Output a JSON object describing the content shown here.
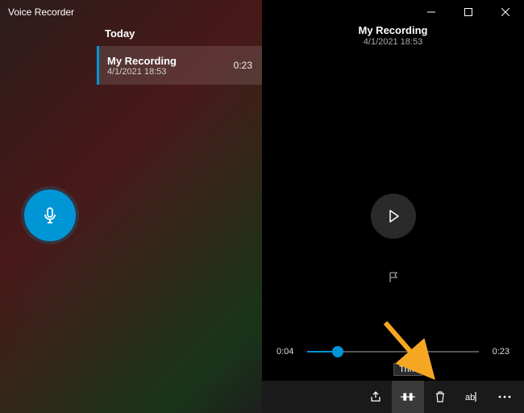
{
  "app": {
    "title": "Voice Recorder"
  },
  "list": {
    "header": "Today",
    "items": [
      {
        "name": "My Recording",
        "date": "4/1/2021 18:53",
        "duration": "0:23"
      }
    ]
  },
  "detail": {
    "name": "My Recording",
    "date": "4/1/2021 18:53"
  },
  "timeline": {
    "current": "0:04",
    "total": "0:23"
  },
  "toolbar": {
    "share": "Share",
    "trim": "Trim",
    "delete": "Delete",
    "rename": "Rename",
    "more": "See more"
  },
  "tooltip": {
    "trim": "Trim"
  },
  "colors": {
    "accent": "#0096d6",
    "arrow": "#f5a623"
  }
}
